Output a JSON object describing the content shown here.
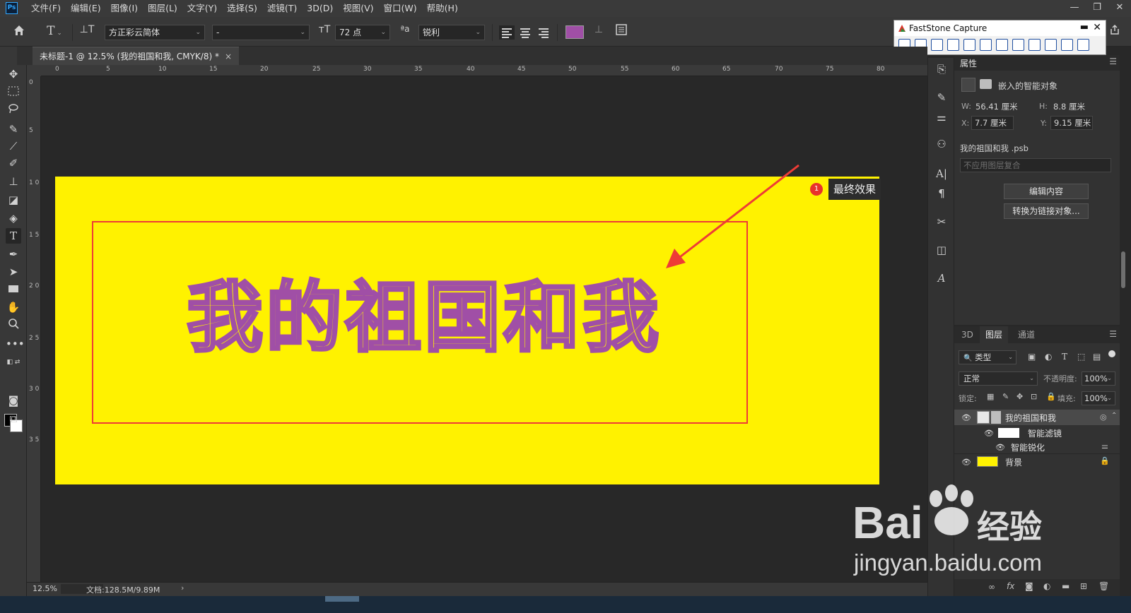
{
  "menubar": {
    "logo": "Ps",
    "items": [
      "文件(F)",
      "编辑(E)",
      "图像(I)",
      "图层(L)",
      "文字(Y)",
      "选择(S)",
      "滤镜(T)",
      "3D(D)",
      "视图(V)",
      "窗口(W)",
      "帮助(H)"
    ],
    "window_controls": [
      "—",
      "❐",
      "✕"
    ]
  },
  "options": {
    "home_icon": "home-icon",
    "tool_icon": "T",
    "font_family": "方正彩云简体",
    "font_style": "-",
    "font_size": "72 点",
    "aa_icon": "ªa",
    "antialias": "锐利",
    "text_color": "#a04fa6"
  },
  "faststone": {
    "title": "FastStone Capture",
    "min": "▬",
    "close": "✕",
    "tool_count": 13
  },
  "document": {
    "tab_title": "未标题-1 @ 12.5% (我的祖国和我, CMYK/8) *",
    "close": "×"
  },
  "ruler": {
    "top_ticks": [
      "0",
      "5",
      "10",
      "15",
      "20",
      "25",
      "30",
      "35",
      "40",
      "45",
      "50",
      "55",
      "60",
      "65",
      "70",
      "75",
      "80"
    ],
    "left_ticks": [
      "0",
      "5",
      "1 0",
      "1 5",
      "2 0",
      "2 5",
      "3 0",
      "3 5"
    ]
  },
  "canvas": {
    "background_color": "#fff200",
    "frame_color": "#ee3c36",
    "text_art": "我的祖国和我",
    "text_outline_color": "#a04fa6",
    "callout_number": "1",
    "callout_label": "最终效果",
    "arrow_color": "#ee3c36"
  },
  "status": {
    "zoom": "12.5%",
    "doc_info": "文档:128.5M/9.89M",
    "caret": "›"
  },
  "properties": {
    "tab": "属性",
    "menu": "☰",
    "type_label": "嵌入的智能对象",
    "w_label": "W:",
    "w_value": "56.41 厘米",
    "h_label": "H:",
    "h_value": "8.8 厘米",
    "x_label": "X:",
    "x_value": "7.7 厘米",
    "y_label": "Y:",
    "y_value": "9.15 厘米",
    "file_name": "我的祖国和我 .psb",
    "comp_placeholder": "不应用图层复合",
    "edit_button": "编辑内容",
    "convert_button": "转换为链接对象..."
  },
  "layers": {
    "tabs": [
      "3D",
      "图层",
      "通道"
    ],
    "active_tab": "图层",
    "menu": "☰",
    "filter_kind": "类型",
    "blend_mode": "正常",
    "opacity_label": "不透明度:",
    "opacity_value": "100%",
    "lock_label": "锁定:",
    "fill_label": "填充:",
    "fill_value": "100%",
    "rows": [
      {
        "name": "我的祖国和我",
        "type": "smart-object",
        "selected": true
      },
      {
        "name": "智能滤镜",
        "type": "smart-filter-mask"
      },
      {
        "name": "智能锐化",
        "type": "filter"
      },
      {
        "name": "背景",
        "type": "background",
        "swatch": "#fff200",
        "locked": true
      }
    ]
  },
  "watermark": {
    "brand_text": "Bai",
    "brand_suffix": "经验",
    "url": "jingyan.baidu.com"
  }
}
